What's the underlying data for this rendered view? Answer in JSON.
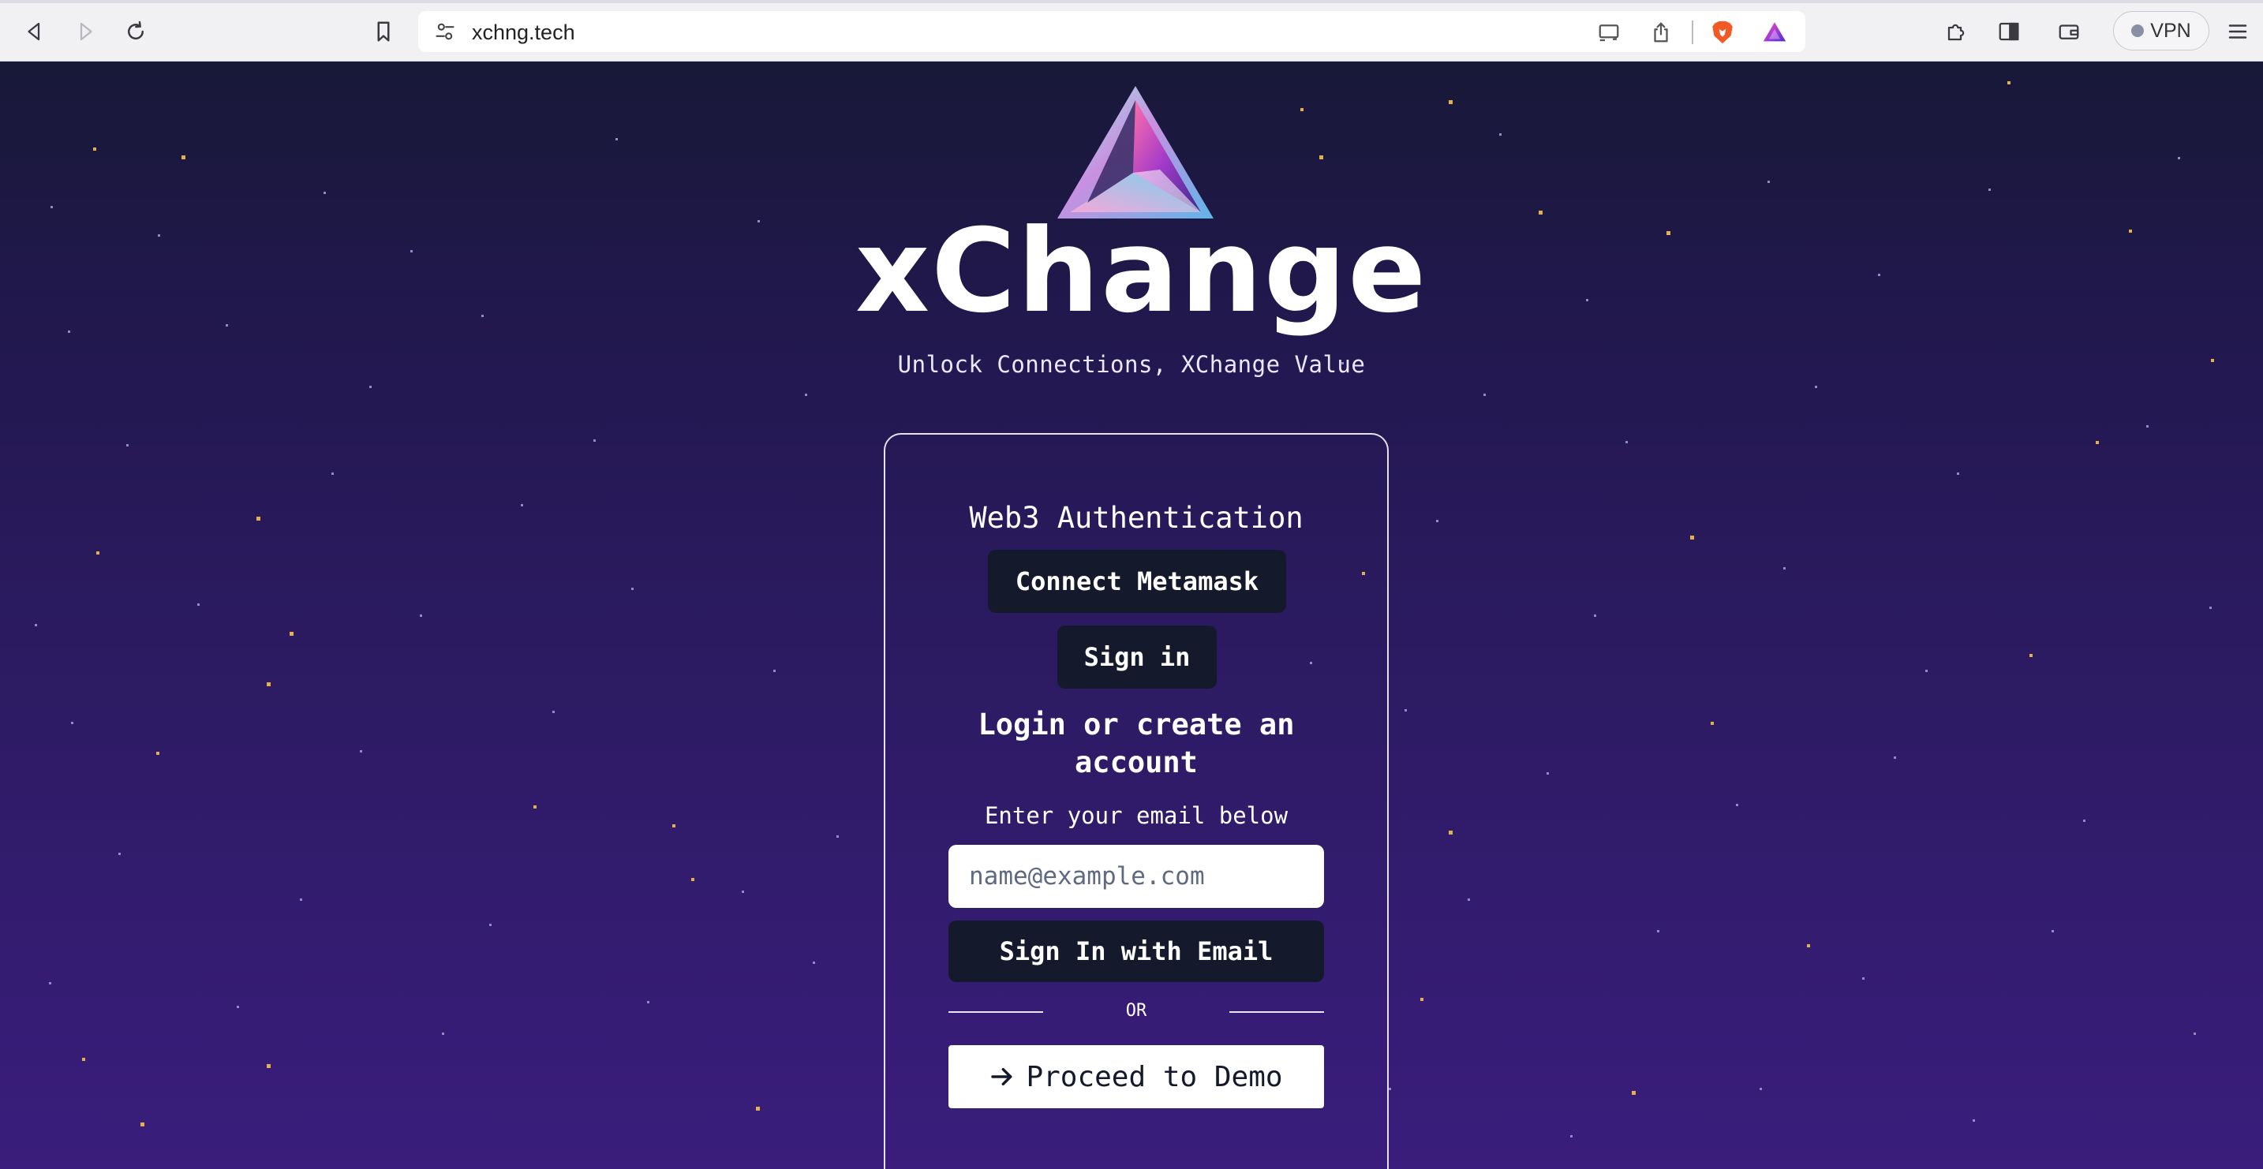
{
  "browser": {
    "url": "xchng.tech",
    "vpn_label": "VPN"
  },
  "hero": {
    "brand": "xChange",
    "tagline": "Unlock Connections, XChange Value"
  },
  "auth": {
    "web3_title": "Web3 Authentication",
    "connect_metamask_label": "Connect Metamask",
    "sign_in_label": "Sign in",
    "login_title": "Login or create an account",
    "email_label": "Enter your email below",
    "email_placeholder": "name@example.com",
    "email_value": "",
    "sign_in_email_label": "Sign In with Email",
    "or_label": "OR",
    "demo_label": "Proceed to Demo"
  },
  "colors": {
    "background_top": "#181838",
    "background_bottom": "#3a1d7c",
    "button_dark": "#141a2c",
    "star": "#e3b04b"
  },
  "icons": {
    "back": "back-arrow-icon",
    "forward": "forward-arrow-icon",
    "reload": "reload-icon",
    "bookmark": "bookmark-icon",
    "site_settings": "tune-icon",
    "cast": "cast-icon",
    "share": "share-icon",
    "brave": "brave-lion-icon",
    "rewards": "brave-rewards-icon",
    "extensions": "puzzle-icon",
    "sidebar": "sidebar-icon",
    "wallet": "wallet-icon",
    "menu": "hamburger-menu-icon",
    "demo_arrow": "arrow-right-icon"
  }
}
